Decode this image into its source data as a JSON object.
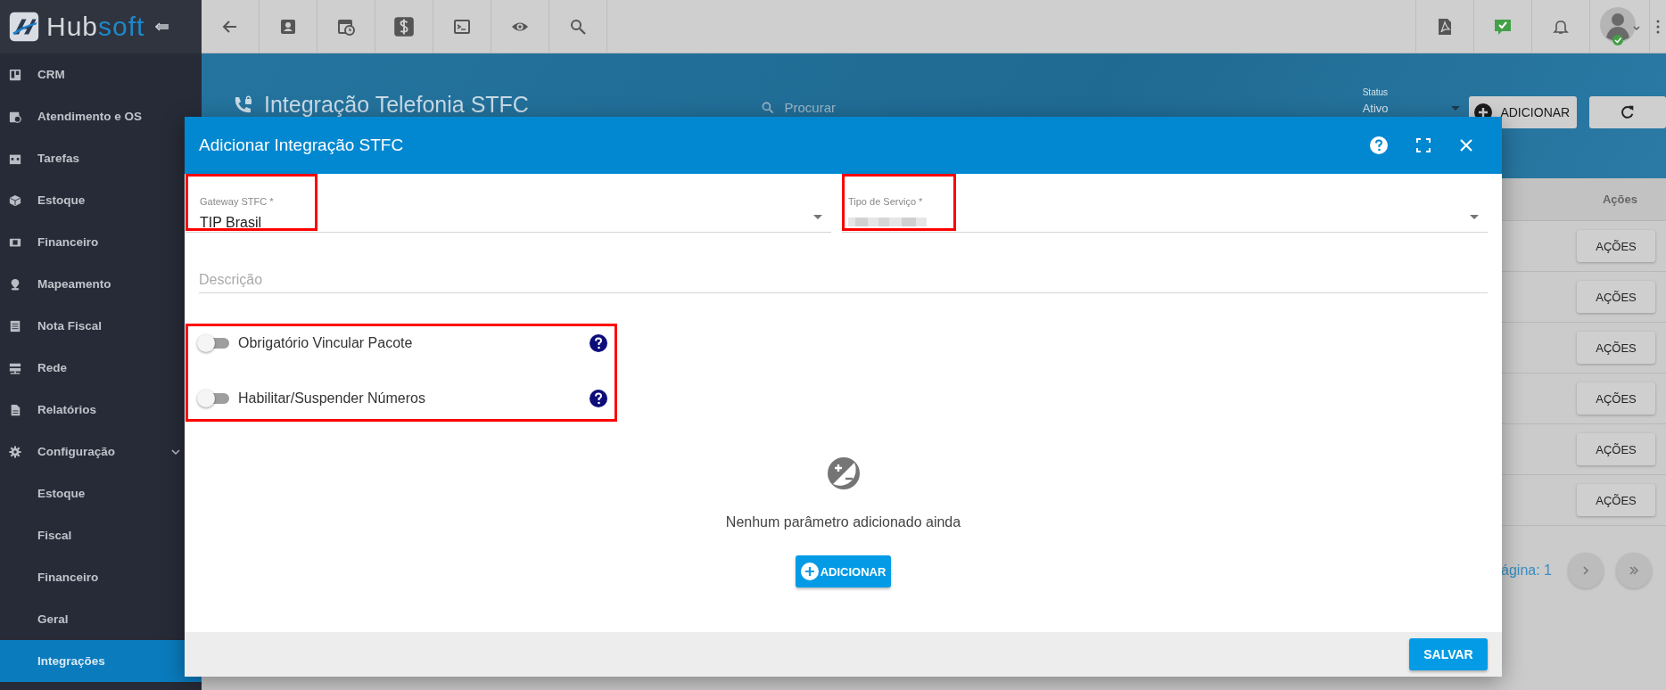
{
  "brand": {
    "main": "Hub",
    "accent": "soft"
  },
  "sidebar": {
    "items": [
      {
        "label": "CRM",
        "selected": false
      },
      {
        "label": "Atendimento e OS",
        "selected": false
      },
      {
        "label": "Tarefas",
        "selected": false
      },
      {
        "label": "Estoque",
        "selected": false
      },
      {
        "label": "Financeiro",
        "selected": false
      },
      {
        "label": "Mapeamento",
        "selected": false
      },
      {
        "label": "Nota Fiscal",
        "selected": false
      },
      {
        "label": "Rede",
        "selected": false
      },
      {
        "label": "Relatórios",
        "selected": false
      },
      {
        "label": "Configuração",
        "selected": false,
        "expanded": true,
        "children": [
          {
            "label": "Estoque",
            "selected": false
          },
          {
            "label": "Fiscal",
            "selected": false
          },
          {
            "label": "Financeiro",
            "selected": false
          },
          {
            "label": "Geral",
            "selected": false
          },
          {
            "label": "Integrações",
            "selected": true
          }
        ]
      }
    ]
  },
  "page": {
    "title": "Integração Telefonia STFC",
    "search": {
      "placeholder": "Procurar"
    },
    "status": {
      "label": "Status",
      "value": "Ativo"
    },
    "add_button": "ADICIONAR",
    "table": {
      "columns": [
        "Ações"
      ],
      "rows": [
        {
          "action": "AÇÕES"
        },
        {
          "action": "AÇÕES"
        },
        {
          "action": "AÇÕES"
        },
        {
          "action": "AÇÕES"
        },
        {
          "action": "AÇÕES"
        },
        {
          "action": "AÇÕES"
        }
      ]
    },
    "pagination": "ágina: 1"
  },
  "modal": {
    "title": "Adicionar Integração STFC",
    "fields": [
      {
        "label": "Gateway STFC *",
        "value": "TIP Brasil",
        "highlighted": true
      },
      {
        "label": "Tipo de Serviço *",
        "highlighted": true,
        "redacted": true
      }
    ],
    "description": {
      "placeholder": "Descrição"
    },
    "toggles_highlighted": true,
    "toggles": [
      {
        "label": "Obrigatório Vincular Pacote",
        "on": false
      },
      {
        "label": "Habilitar/Suspender Números",
        "on": false
      }
    ],
    "empty_text": "Nenhum parâmetro adicionado ainda",
    "add_button": "ADICIONAR",
    "save_button": "SALVAR"
  }
}
